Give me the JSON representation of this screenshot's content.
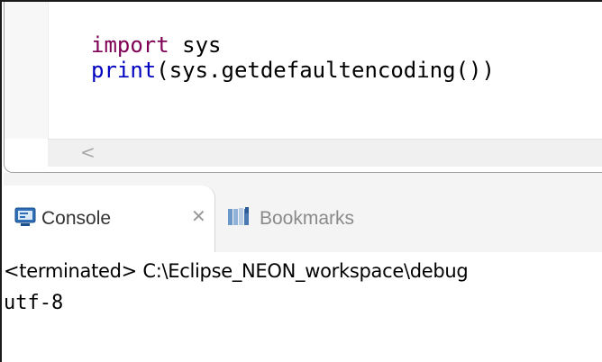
{
  "editor": {
    "lines": [
      {
        "keyword": "import",
        "rest": " sys"
      },
      {
        "builtin": "print",
        "rest": "(sys.getdefaultencoding())"
      }
    ],
    "scroll_left_glyph": "<"
  },
  "views": {
    "tabs": [
      {
        "label": "Console",
        "icon": "console-icon",
        "active": true,
        "close_glyph": "✕"
      },
      {
        "label": "Bookmarks",
        "icon": "bookmarks-icon",
        "active": false
      }
    ]
  },
  "console": {
    "terminated_line": "<terminated> C:\\Eclipse_NEON_workspace\\debug",
    "output": "utf-8"
  },
  "colors": {
    "keyword": "#7f0055",
    "builtin": "#0000c0",
    "frame": "#1a1a1a"
  }
}
